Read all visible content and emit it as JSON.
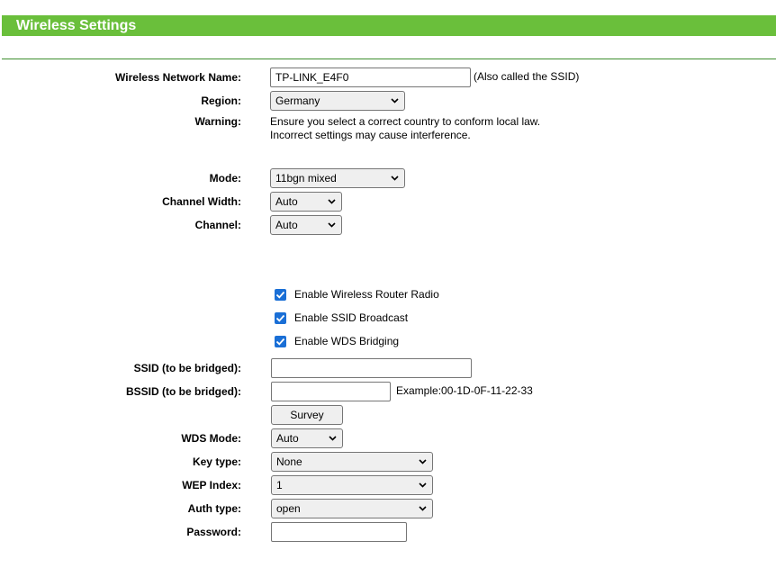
{
  "header": {
    "title": "Wireless Settings"
  },
  "fields": {
    "network_name": {
      "label": "Wireless Network Name:",
      "value": "TP-LINK_E4F0",
      "hint": "(Also called the SSID)"
    },
    "region": {
      "label": "Region:",
      "value": "Germany"
    },
    "warning": {
      "label": "Warning:",
      "line1": "Ensure you select a correct country to conform local law.",
      "line2": "Incorrect settings may cause interference."
    },
    "mode": {
      "label": "Mode:",
      "value": "11bgn mixed"
    },
    "channel_width": {
      "label": "Channel Width:",
      "value": "Auto"
    },
    "channel": {
      "label": "Channel:",
      "value": "Auto"
    },
    "enable_radio": {
      "label": "Enable Wireless Router Radio",
      "checked": true
    },
    "enable_ssid_broadcast": {
      "label": "Enable SSID Broadcast",
      "checked": true
    },
    "enable_wds": {
      "label": "Enable WDS Bridging",
      "checked": true
    },
    "ssid_bridged": {
      "label": "SSID (to be bridged):",
      "value": ""
    },
    "bssid_bridged": {
      "label": "BSSID (to be bridged):",
      "value": "",
      "example": "Example:00-1D-0F-11-22-33"
    },
    "survey_button": {
      "label": "Survey"
    },
    "wds_mode": {
      "label": "WDS Mode:",
      "value": "Auto"
    },
    "key_type": {
      "label": "Key type:",
      "value": "None"
    },
    "wep_index": {
      "label": "WEP Index:",
      "value": "1"
    },
    "auth_type": {
      "label": "Auth type:",
      "value": "open"
    },
    "password": {
      "label": "Password:",
      "value": ""
    }
  },
  "icons": {
    "chevron": "chevron-down-icon",
    "check": "checkmark-icon"
  },
  "colors": {
    "header_green": "#6abf3b",
    "checkbox_blue": "#1a6fd6"
  }
}
